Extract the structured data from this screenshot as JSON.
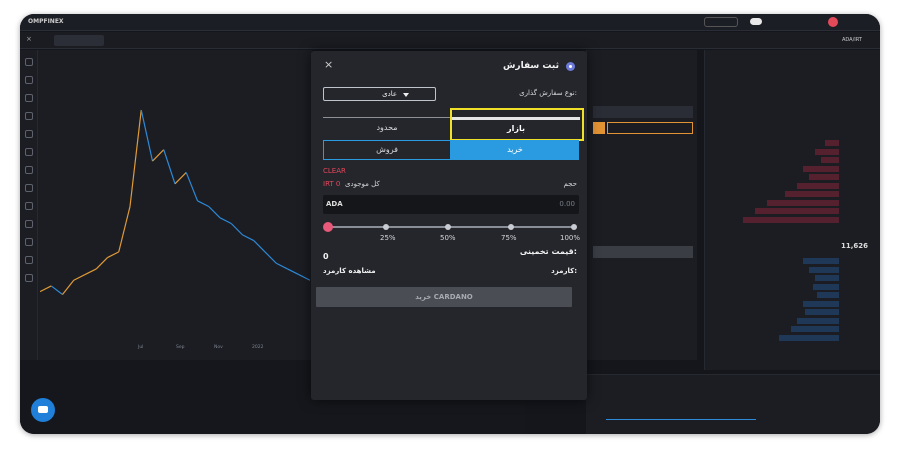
{
  "app": {
    "logo": "OMPFINEX",
    "nav": [
      "",
      "",
      "",
      "",
      ""
    ],
    "top_right": {
      "balance_label": "",
      "user_label": ""
    },
    "ticker": "ADA/IRT",
    "price": "11,626",
    "price_change": ""
  },
  "subbar": {
    "chip_label": "",
    "close_label": "×"
  },
  "chart": {
    "symbol_line": "",
    "legend_1": "",
    "legend_2": "",
    "x_ticks": [
      "",
      "",
      "Jul",
      "Sep",
      "Nov",
      "2022",
      "",
      ""
    ],
    "foot": "",
    "colors": {
      "up": "#e09a38",
      "down": "#2d8ad8"
    },
    "price_points": [
      10,
      12,
      9,
      14,
      16,
      18,
      22,
      24,
      40,
      74,
      56,
      60,
      48,
      52,
      42,
      40,
      36,
      34,
      30,
      28,
      24,
      20,
      18,
      16,
      14
    ]
  },
  "orderbook": {
    "title": "",
    "mid_price": "11,626",
    "asks": [
      {
        "total": "",
        "amount": "",
        "price": "",
        "fill": 0.12
      },
      {
        "total": "",
        "amount": "",
        "price": "",
        "fill": 0.2
      },
      {
        "total": "",
        "amount": "",
        "price": "",
        "fill": 0.15
      },
      {
        "total": "",
        "amount": "",
        "price": "",
        "fill": 0.3
      },
      {
        "total": "",
        "amount": "",
        "price": "",
        "fill": 0.25
      },
      {
        "total": "",
        "amount": "",
        "price": "",
        "fill": 0.35
      },
      {
        "total": "",
        "amount": "",
        "price": "",
        "fill": 0.45
      },
      {
        "total": "",
        "amount": "",
        "price": "",
        "fill": 0.6
      },
      {
        "total": "",
        "amount": "",
        "price": "",
        "fill": 0.7
      },
      {
        "total": "",
        "amount": "",
        "price": "",
        "fill": 0.8
      }
    ],
    "bids": [
      {
        "total": "",
        "amount": "",
        "price": "",
        "fill": 0.3
      },
      {
        "total": "",
        "amount": "",
        "price": "",
        "fill": 0.25
      },
      {
        "total": "",
        "amount": "",
        "price": "",
        "fill": 0.2
      },
      {
        "total": "",
        "amount": "",
        "price": "",
        "fill": 0.22
      },
      {
        "total": "",
        "amount": "",
        "price": "",
        "fill": 0.18
      },
      {
        "total": "",
        "amount": "",
        "price": "",
        "fill": 0.3
      },
      {
        "total": "",
        "amount": "",
        "price": "",
        "fill": 0.28
      },
      {
        "total": "",
        "amount": "",
        "price": "",
        "fill": 0.35
      },
      {
        "total": "",
        "amount": "",
        "price": "",
        "fill": 0.4
      },
      {
        "total": "",
        "amount": "",
        "price": "",
        "fill": 0.5
      }
    ]
  },
  "modal": {
    "title": "ثبت سفارش",
    "close_icon": "×",
    "order_type_label": "نوع سفارش گذاری:",
    "order_type_value": "عادی",
    "tabs": {
      "limit": "محدود",
      "market": "بازار"
    },
    "sides": {
      "sell": "فروش",
      "buy": "خرید"
    },
    "clear": "CLEAR",
    "balance_label": "کل موجودی",
    "balance_value": "IRT 0",
    "volume_label": "حجم",
    "amount_unit": "ADA",
    "amount_placeholder": "0.00",
    "slider_value": 0,
    "slider_pcts": [
      "25%",
      "50%",
      "75%",
      "100%"
    ],
    "estimated_price_label": "قیمت تخمینی:",
    "estimated_price_value": "0",
    "fee_label": "کارمزد:",
    "fee_link": "مشاهده کارمزد",
    "submit": "خرید CARDANO"
  }
}
